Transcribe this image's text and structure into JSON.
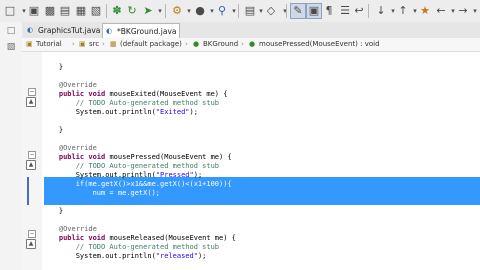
{
  "toolbar": {
    "icons": [
      "new-icon",
      "save-icon",
      "print-icon",
      "build-icon",
      "debug-icon",
      "run-icon",
      "external-tools-icon",
      "new-java-project-icon",
      "new-package-icon",
      "new-class-icon",
      "open-type-icon",
      "search-icon",
      "perspective-icon",
      "toggle-mark-icon",
      "annotation-next-icon",
      "annotation-prev-icon",
      "back-icon",
      "forward-icon"
    ]
  },
  "tabs": [
    {
      "label": "GraphicsTut.java",
      "active": false
    },
    {
      "label": "*BKGround.java",
      "active": true
    }
  ],
  "breadcrumb": [
    "Tutorial",
    "src",
    "(default package)",
    "BKGround",
    "mousePressed(MouseEvent) : void"
  ],
  "code": {
    "l1": "    }",
    "l2": "",
    "l3": "    @Override",
    "l4_kw": "    public void ",
    "l4_rest": "mouseExited(MouseEvent me) {",
    "l5": "        // TODO Auto-generated method stub",
    "l6_pre": "        System.out.println(",
    "l6_str": "\"Exited\"",
    "l6_post": ");",
    "l7": "",
    "l8": "    }",
    "l9": "",
    "l10": "    @Override",
    "l11_kw": "    public void ",
    "l11_rest": "mousePressed(MouseEvent me) {",
    "l12": "        // TODO Auto-generated method stub",
    "l13_pre": "        System.out.println(",
    "l13_str": "\"Pressed\"",
    "l13_post": ");",
    "l14": "        if(me.getX()>x1&&me.getX()<(x1+100)){",
    "l15": "            num = me.getX();",
    "l16": "",
    "l17": "    }",
    "l18": "",
    "l19": "    @Override",
    "l20_kw": "    public void ",
    "l20_rest": "mouseReleased(MouseEvent me) {",
    "l21": "        // TODO Auto-generated method stub",
    "l22_pre": "        System.out.println(",
    "l22_str": "\"released\"",
    "l22_post": ");"
  },
  "colors": {
    "selection": "#3399ff",
    "keyword": "#7f0055",
    "comment": "#3f7f5f",
    "string": "#2a00ff"
  }
}
